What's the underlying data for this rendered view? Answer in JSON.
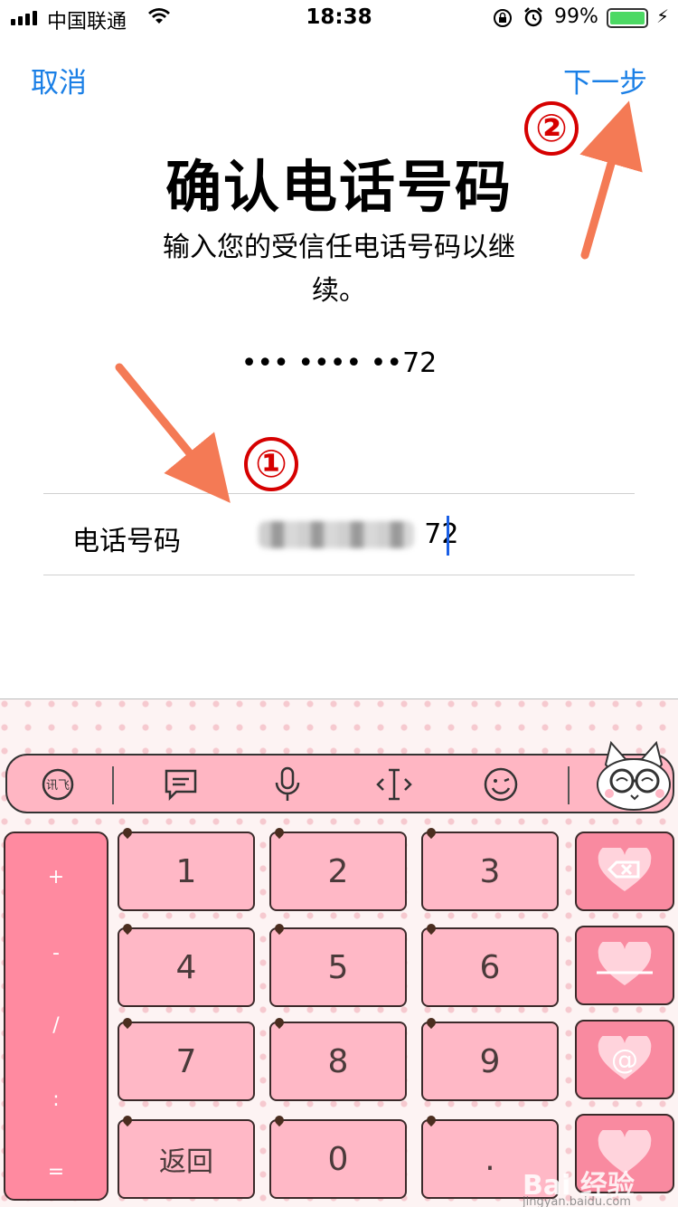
{
  "status_bar": {
    "carrier": "中国联通",
    "time": "18:38",
    "battery": "99%",
    "icons": [
      "signal-icon",
      "wifi-icon",
      "orientation-lock-icon",
      "alarm-icon",
      "battery-icon",
      "charging-icon"
    ]
  },
  "nav": {
    "cancel_label": "取消",
    "next_label": "下一步",
    "accent_color": "#1a7fe6"
  },
  "page": {
    "title": "确认电话号码",
    "subtitle": "输入您的受信任电话号码以继续。",
    "masked_number": "••• •••• ••72"
  },
  "phone_field": {
    "label": "电话号码",
    "value_visible_suffix": "72"
  },
  "annotations": {
    "step1": "①",
    "step2": "②",
    "color": "#d60000"
  },
  "keyboard": {
    "toolbar_icons": [
      "ifly-logo-icon",
      "message-icon",
      "microphone-icon",
      "cursor-move-icon",
      "emoji-icon"
    ],
    "side_symbols": [
      "+",
      "-",
      "/",
      ":",
      "="
    ],
    "keys": [
      "1",
      "2",
      "3",
      "4",
      "5",
      "6",
      "7",
      "8",
      "9",
      "返回",
      "0",
      "."
    ],
    "func_keys": [
      "backspace-icon",
      "space-icon",
      "at-icon",
      "enter-icon"
    ],
    "at_symbol": "@"
  },
  "watermark": {
    "brand": "Bai 经验",
    "url": "jingyan.baidu.com"
  }
}
